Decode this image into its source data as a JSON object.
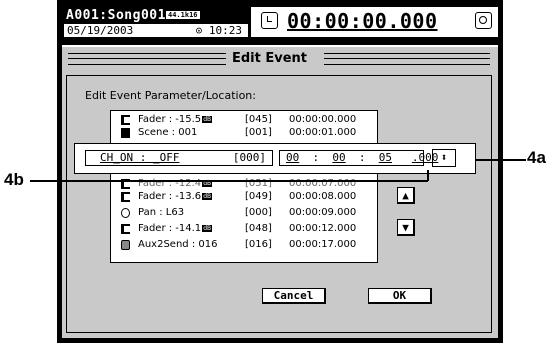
{
  "header": {
    "song": "A001:Song001",
    "sample_rate": "44.1k16",
    "date": "05/19/2003",
    "clock": "⊙ 10:23",
    "timecode": "00:00:00.000"
  },
  "dialog": {
    "title": "Edit Event",
    "caption": "Edit Event Parameter/Location:",
    "events": [
      {
        "icon": "fader-icon",
        "name": "Fader : -15.5",
        "db": "dB",
        "index": "[045]",
        "time": "00:00:00.000"
      },
      {
        "icon": "scene-icon",
        "name": "Scene : 001",
        "db": "",
        "index": "[001]",
        "time": "00:00:01.000"
      },
      {
        "icon": "fader-icon",
        "name": "Fader : -12.4",
        "db": "dB",
        "index": "[051]",
        "time": "00:00:07.000"
      },
      {
        "icon": "fader-icon",
        "name": "Fader : -13.6",
        "db": "dB",
        "index": "[049]",
        "time": "00:00:08.000"
      },
      {
        "icon": "pan-icon",
        "name": "Pan : L63",
        "db": "",
        "index": "[000]",
        "time": "00:00:09.000"
      },
      {
        "icon": "fader-icon",
        "name": "Fader : -14.1",
        "db": "dB",
        "index": "[048]",
        "time": "00:00:12.000"
      },
      {
        "icon": "aux-send-icon",
        "name": "Aux2Send : 016",
        "db": "",
        "index": "[016]",
        "time": "00:00:17.000"
      }
    ],
    "edit": {
      "param": "CH_ON : _OFF",
      "value_index": "[000]",
      "hh": "00",
      "mm": "00",
      "ss": "05",
      "ms": ".000",
      "updown": "⬍"
    },
    "scroll_up": "▲",
    "scroll_down": "▼",
    "cancel_label": "Cancel",
    "ok_label": "OK"
  },
  "callouts": {
    "left": "4b",
    "right": "4a"
  }
}
